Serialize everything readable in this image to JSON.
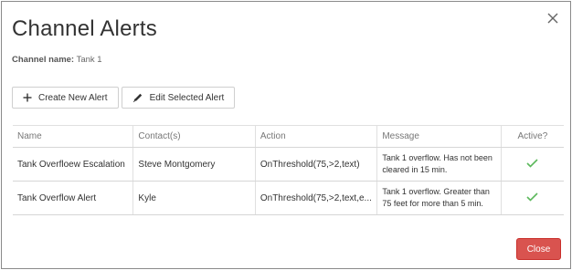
{
  "dialog": {
    "title": "Channel Alerts",
    "channel_label": "Channel name:",
    "channel_value": "Tank 1"
  },
  "toolbar": {
    "create_label": "Create New Alert",
    "edit_label": "Edit Selected Alert"
  },
  "table": {
    "headers": [
      "Name",
      "Contact(s)",
      "Action",
      "Message",
      "Active?"
    ],
    "rows": [
      {
        "name": "Tank Overfloew Escalation",
        "contact": "Steve Montgomery",
        "action": "OnThreshold(75,>2,text)",
        "message": "Tank 1 overflow. Has not been cleared in 15 min.",
        "active": true
      },
      {
        "name": "Tank Overflow Alert",
        "contact": "Kyle",
        "action": "OnThreshold(75,>2,text,e...",
        "message": "Tank 1 overflow. Greater than 75 feet for more than 5 min.",
        "active": true
      }
    ]
  },
  "footer": {
    "close_label": "Close"
  },
  "colors": {
    "accent": "#d9534f",
    "check": "#5cb85c"
  },
  "icons": [
    "close-icon",
    "plus-icon",
    "pencil-icon",
    "check-icon"
  ]
}
